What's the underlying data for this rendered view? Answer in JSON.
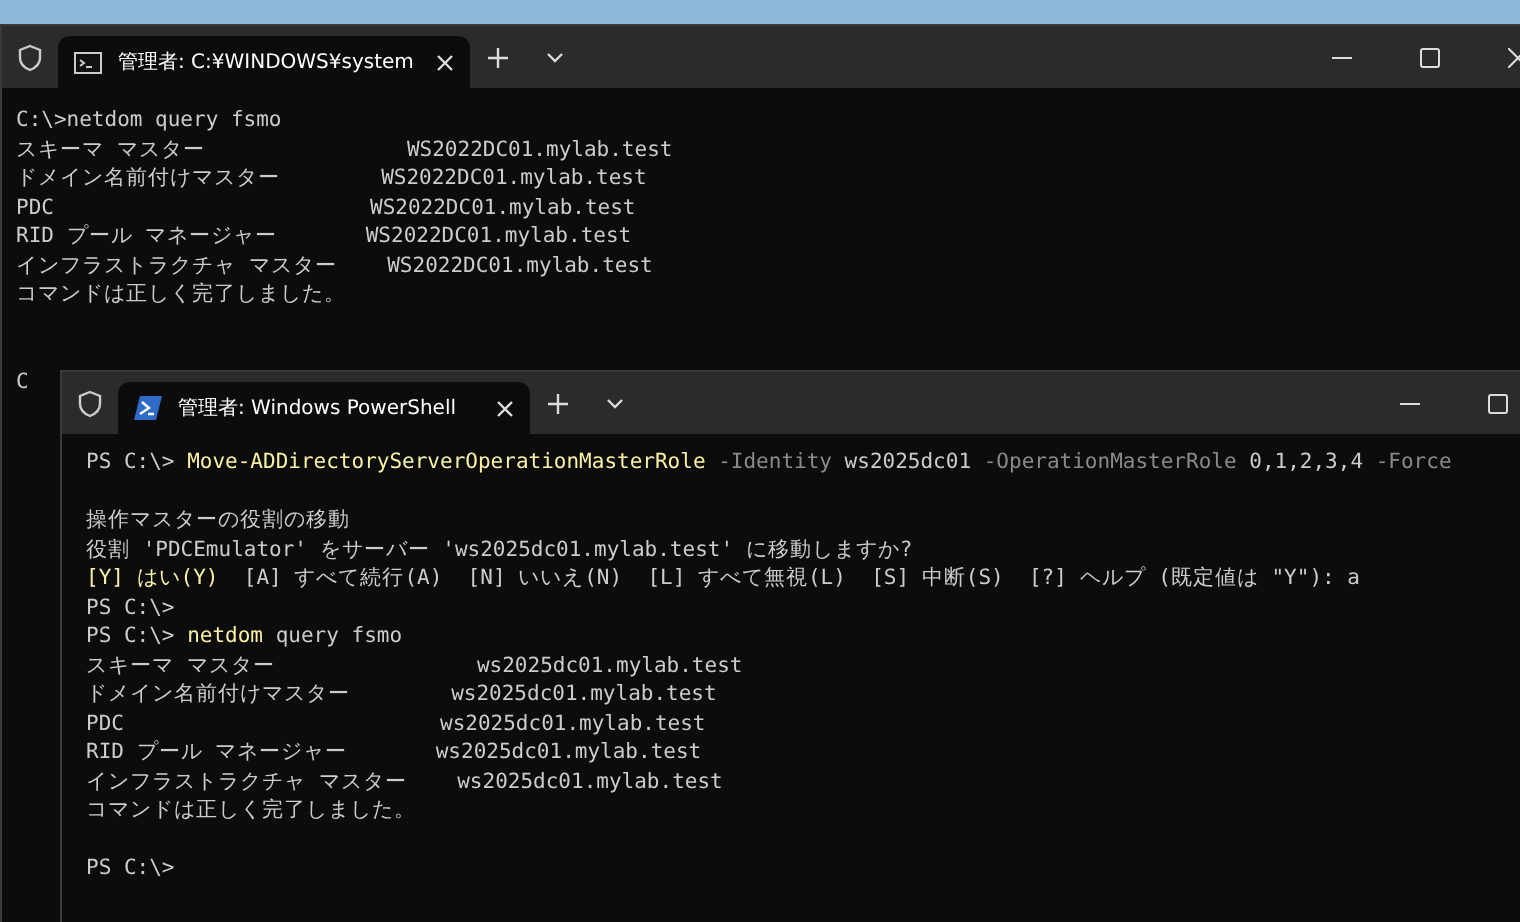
{
  "windows": [
    {
      "kind": "cmd",
      "tab_title": "管理者: C:¥WINDOWS¥system",
      "blocks": [
        {
          "lines": [
            {
              "segments": [
                {
                  "text": "C:\\>netdom query fsmo",
                  "kind": "plain"
                }
              ]
            },
            {
              "segments": [
                {
                  "text": "スキーマ マスター                WS2022DC01.mylab.test",
                  "kind": "plain"
                }
              ]
            },
            {
              "segments": [
                {
                  "text": "ドメイン名前付けマスター        WS2022DC01.mylab.test",
                  "kind": "plain"
                }
              ]
            },
            {
              "segments": [
                {
                  "text": "PDC                         WS2022DC01.mylab.test",
                  "kind": "plain"
                }
              ]
            },
            {
              "segments": [
                {
                  "text": "RID プール マネージャー       WS2022DC01.mylab.test",
                  "kind": "plain"
                }
              ]
            },
            {
              "segments": [
                {
                  "text": "インフラストラクチャ マスター    WS2022DC01.mylab.test",
                  "kind": "plain"
                }
              ]
            },
            {
              "segments": [
                {
                  "text": "コマンドは正しく完了しました。",
                  "kind": "plain"
                }
              ]
            }
          ]
        },
        {
          "lines": [
            {
              "segments": [
                {
                  "text": "C",
                  "kind": "plain"
                }
              ]
            }
          ]
        }
      ]
    },
    {
      "kind": "powershell",
      "tab_title": "管理者: Windows PowerShell",
      "blocks": [
        {
          "lines": [
            {
              "segments": [
                {
                  "text": "PS C:\\> ",
                  "kind": "plain"
                },
                {
                  "text": "Move-ADDirectoryServerOperationMasterRole",
                  "kind": "command"
                },
                {
                  "text": " -Identity",
                  "kind": "param"
                },
                {
                  "text": " ws2025dc01",
                  "kind": "plain"
                },
                {
                  "text": " -OperationMasterRole",
                  "kind": "param"
                },
                {
                  "text": " 0,1,2,3,4",
                  "kind": "plain"
                },
                {
                  "text": " -Force",
                  "kind": "param"
                }
              ]
            }
          ]
        },
        {
          "lines": [
            {
              "segments": [
                {
                  "text": "操作マスターの役割の移動",
                  "kind": "plain"
                }
              ]
            },
            {
              "segments": [
                {
                  "text": "役割 'PDCEmulator' をサーバー 'ws2025dc01.mylab.test' に移動しますか?",
                  "kind": "plain"
                }
              ]
            },
            {
              "segments": [
                {
                  "text": "[Y] はい(Y)",
                  "kind": "command"
                },
                {
                  "text": "  [A] すべて続行(A)  [N] いいえ(N)  [L] すべて無視(L)  [S] 中断(S)  [?] ヘルプ (既定値は \"Y\"): a",
                  "kind": "plain"
                }
              ]
            },
            {
              "segments": [
                {
                  "text": "PS C:\\>",
                  "kind": "plain"
                }
              ]
            },
            {
              "segments": [
                {
                  "text": "PS C:\\> ",
                  "kind": "plain"
                },
                {
                  "text": "netdom",
                  "kind": "command"
                },
                {
                  "text": " query fsmo",
                  "kind": "plain"
                }
              ]
            },
            {
              "segments": [
                {
                  "text": "スキーマ マスター                ws2025dc01.mylab.test",
                  "kind": "plain"
                }
              ]
            },
            {
              "segments": [
                {
                  "text": "ドメイン名前付けマスター        ws2025dc01.mylab.test",
                  "kind": "plain"
                }
              ]
            },
            {
              "segments": [
                {
                  "text": "PDC                         ws2025dc01.mylab.test",
                  "kind": "plain"
                }
              ]
            },
            {
              "segments": [
                {
                  "text": "RID プール マネージャー       ws2025dc01.mylab.test",
                  "kind": "plain"
                }
              ]
            },
            {
              "segments": [
                {
                  "text": "インフラストラクチャ マスター    ws2025dc01.mylab.test",
                  "kind": "plain"
                }
              ]
            },
            {
              "segments": [
                {
                  "text": "コマンドは正しく完了しました。",
                  "kind": "plain"
                }
              ]
            }
          ]
        },
        {
          "lines": [
            {
              "segments": [
                {
                  "text": "PS C:\\>",
                  "kind": "plain"
                }
              ]
            }
          ]
        }
      ]
    }
  ]
}
